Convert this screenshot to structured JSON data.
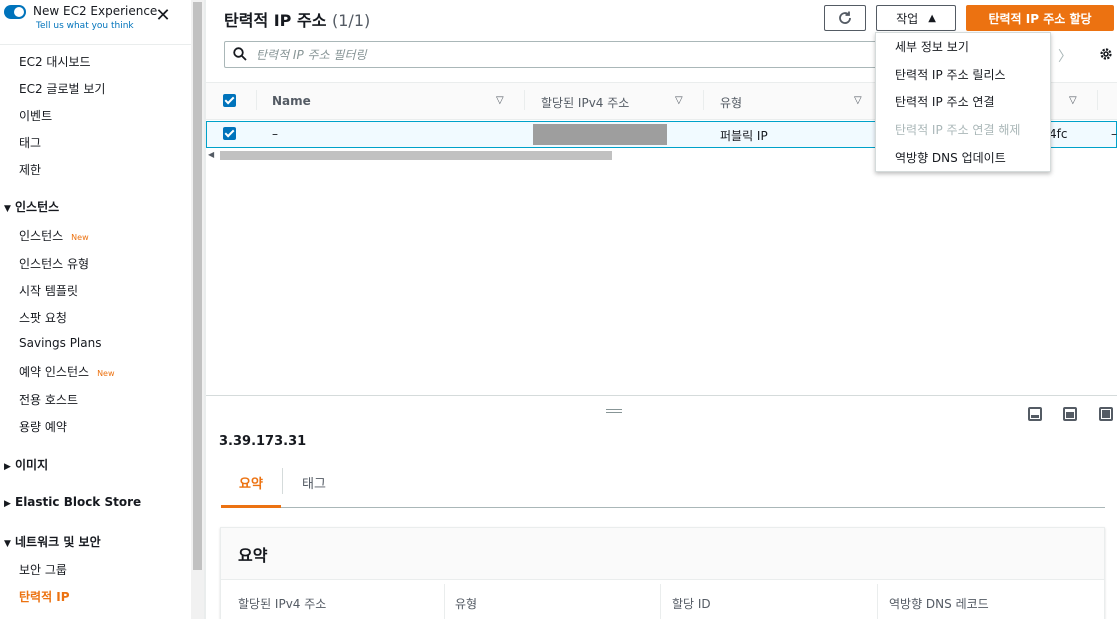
{
  "sidebar": {
    "experience_title": "New EC2 Experience",
    "experience_sub": "Tell us what you think",
    "items": [
      {
        "label": "EC2 대시보드"
      },
      {
        "label": "EC2 글로벌 보기"
      },
      {
        "label": "이벤트"
      },
      {
        "label": "태그"
      },
      {
        "label": "제한"
      }
    ],
    "section_instances": "인스턴스",
    "instances_items": [
      {
        "label": "인스턴스",
        "badge": "New"
      },
      {
        "label": "인스턴스 유형"
      },
      {
        "label": "시작 템플릿"
      },
      {
        "label": "스팟 요청"
      },
      {
        "label": "Savings Plans"
      },
      {
        "label": "예약 인스턴스",
        "badge": "New"
      },
      {
        "label": "전용 호스트"
      },
      {
        "label": "용량 예약"
      }
    ],
    "section_images": "이미지",
    "section_ebs": "Elastic Block Store",
    "section_network": "네트워크 및 보안",
    "network_items": [
      {
        "label": "보안 그룹"
      },
      {
        "label": "탄력적 IP"
      }
    ]
  },
  "header": {
    "title": "탄력적 IP 주소",
    "count": "(1/1)",
    "actions_label": "작업",
    "primary_label": "탄력적 IP 주소 할당"
  },
  "search": {
    "placeholder": "탄력적 IP 주소 필터링"
  },
  "table": {
    "columns": [
      "Name",
      "할당된 IPv4 주소",
      "유형"
    ],
    "rows": [
      {
        "name": "–",
        "ipv4": "",
        "type": "퍼블릭 IP",
        "truncated_col": "4fc",
        "truncated_col2": "–"
      }
    ]
  },
  "actions_menu": {
    "items": [
      {
        "label": "세부 정보 보기",
        "disabled": false
      },
      {
        "label": "탄력적 IP 주소 릴리스",
        "disabled": false
      },
      {
        "label": "탄력적 IP 주소 연결",
        "disabled": false
      },
      {
        "label": "탄력적 IP 주소 연결 해제",
        "disabled": true
      },
      {
        "label": "역방향 DNS 업데이트",
        "disabled": false
      }
    ]
  },
  "detail": {
    "ip": "3.39.173.31",
    "tabs": [
      "요약",
      "태그"
    ],
    "active_tab": "요약",
    "card_title": "요약",
    "fields": [
      "할당된 IPv4 주소",
      "유형",
      "할당 ID",
      "역방향 DNS 레코드"
    ]
  },
  "colors": {
    "accent": "#ec7211",
    "link": "#0073bb",
    "selected_row_bg": "#f1faff",
    "selected_row_border": "#00a1c9"
  }
}
